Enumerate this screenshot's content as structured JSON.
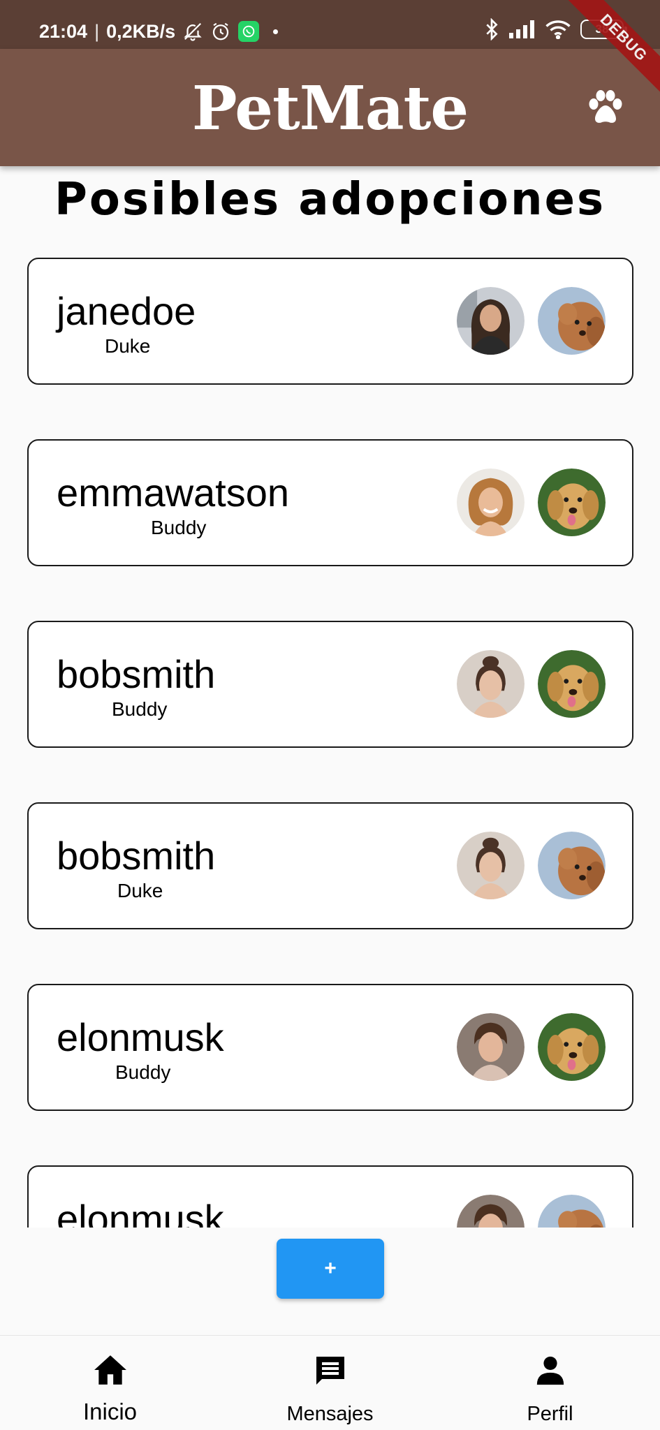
{
  "status_bar": {
    "time": "21:04",
    "network_speed": "0,2KB/s",
    "battery": "38",
    "icons": [
      "bell-off-icon",
      "alarm-icon",
      "whatsapp-icon",
      "bluetooth-icon",
      "signal-icon",
      "wifi-icon",
      "battery-icon"
    ]
  },
  "debug_banner": "DEBUG",
  "app_bar": {
    "title": "PetMate",
    "action_icon": "paw-icon",
    "color": "#795548"
  },
  "page": {
    "heading": "Posibles adopciones"
  },
  "adoptions": [
    {
      "username": "janedoe",
      "pet": "Duke",
      "person_avatar": "woman-long-dark-hair",
      "pet_avatar": "poodle"
    },
    {
      "username": "emmawatson",
      "pet": "Buddy",
      "person_avatar": "woman-curly-hair",
      "pet_avatar": "golden-retriever"
    },
    {
      "username": "bobsmith",
      "pet": "Buddy",
      "person_avatar": "woman-hair-bun",
      "pet_avatar": "golden-retriever"
    },
    {
      "username": "bobsmith",
      "pet": "Duke",
      "person_avatar": "woman-hair-bun",
      "pet_avatar": "poodle"
    },
    {
      "username": "elonmusk",
      "pet": "Buddy",
      "person_avatar": "man-brown-hair",
      "pet_avatar": "golden-retriever"
    },
    {
      "username": "elonmusk",
      "pet": "",
      "person_avatar": "man-brown-hair",
      "pet_avatar": "poodle"
    }
  ],
  "fab": {
    "label": "+",
    "color": "#2196f3"
  },
  "bottom_nav": {
    "items": [
      {
        "label": "Inicio",
        "icon": "home-icon",
        "active": true
      },
      {
        "label": "Mensajes",
        "icon": "chat-icon",
        "active": false
      },
      {
        "label": "Perfil",
        "icon": "person-icon",
        "active": false
      }
    ]
  }
}
